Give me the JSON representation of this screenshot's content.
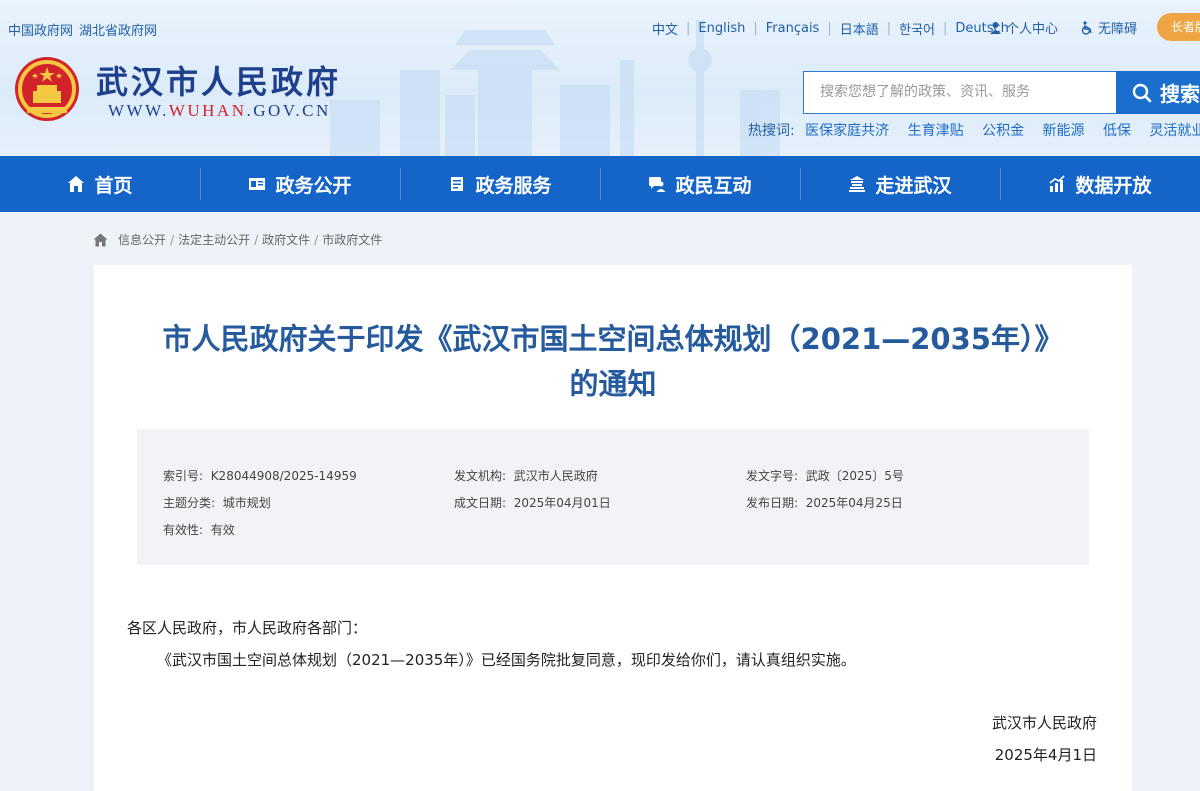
{
  "top_links": [
    "中国政府网",
    "湖北省政府网"
  ],
  "languages": [
    "中文",
    "English",
    "Français",
    "日本語",
    "한국어",
    "Deutsch"
  ],
  "utility": {
    "personal_center": "个人中心",
    "accessibility": "无障碍",
    "elder_mode": "长者版"
  },
  "site": {
    "name": "武汉市人民政府",
    "url_prefix": "WWW.",
    "url_brand": "WUHAN",
    "url_suffix": ".GOV.CN"
  },
  "search": {
    "placeholder": "搜索您想了解的政策、资讯、服务",
    "button": "搜索"
  },
  "hot_search": {
    "label": "热搜词:",
    "keywords": [
      "医保家庭共济",
      "生育津贴",
      "公积金",
      "新能源",
      "低保",
      "灵活就业登记"
    ]
  },
  "nav": [
    {
      "label": "首页",
      "icon": "home-icon"
    },
    {
      "label": "政务公开",
      "icon": "id-card-icon"
    },
    {
      "label": "政务服务",
      "icon": "clipboard-icon"
    },
    {
      "label": "政民互动",
      "icon": "chat-user-icon"
    },
    {
      "label": "走进武汉",
      "icon": "building-icon"
    },
    {
      "label": "数据开放",
      "icon": "chart-icon"
    }
  ],
  "breadcrumb": [
    "信息公开",
    "法定主动公开",
    "政府文件",
    "市政府文件"
  ],
  "document": {
    "title": "市人民政府关于印发《武汉市国土空间总体规划（2021—2035年）》的通知",
    "meta": {
      "index_label": "索引号:",
      "index_value": "K28044908/2025-14959",
      "issuer_label": "发文机构:",
      "issuer_value": "武汉市人民政府",
      "doc_no_label": "发文字号:",
      "doc_no_value": "武政〔2025〕5号",
      "topic_label": "主题分类:",
      "topic_value": "城市规划",
      "made_date_label": "成文日期:",
      "made_date_value": "2025年04月01日",
      "pub_date_label": "发布日期:",
      "pub_date_value": "2025年04月25日",
      "validity_label": "有效性:",
      "validity_value": "有效"
    },
    "salutation": "各区人民政府，市人民政府各部门：",
    "paragraph": "《武汉市国土空间总体规划（2021—2035年）》已经国务院批复同意，现印发给你们，请认真组织实施。",
    "signature": "武汉市人民政府",
    "sign_date": "2025年4月1日"
  }
}
